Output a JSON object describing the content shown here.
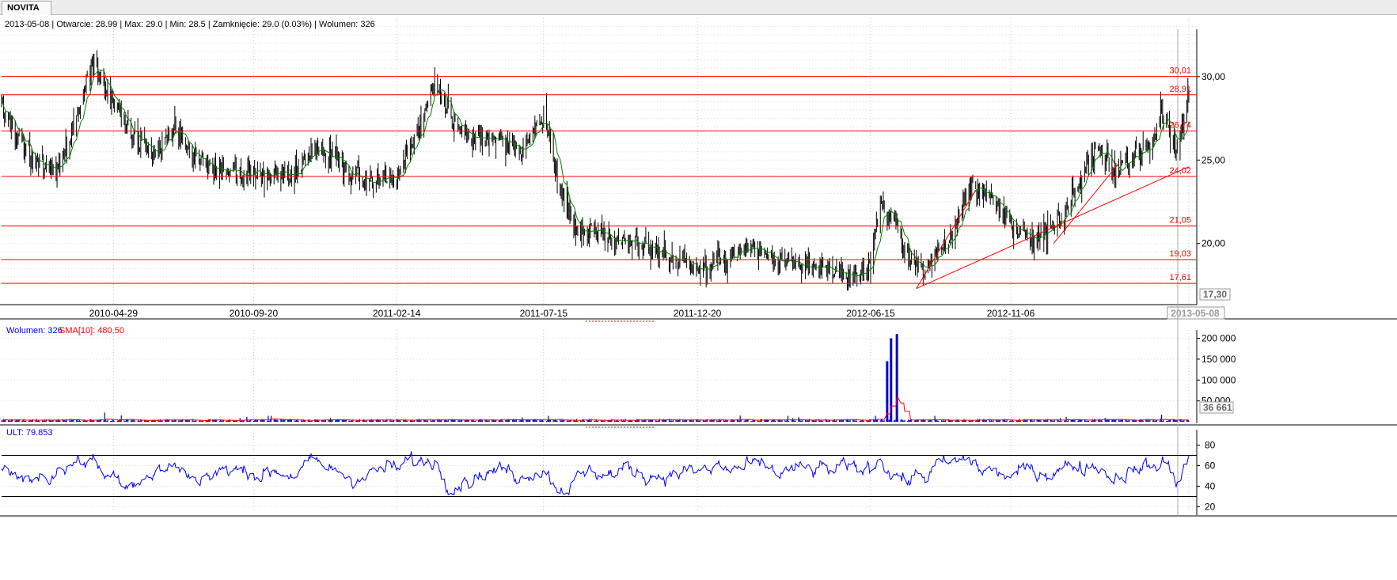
{
  "tabs": [
    {
      "label": "NOVITA"
    }
  ],
  "header": {
    "info_line": "2013-05-08 | Otwarcie: 28.99 | Max: 29.0 | Min: 28.5 | Zamknięcie: 29.0 (0.03%)  | Wolumen: 326"
  },
  "colors": {
    "price_bars": "#000000",
    "moving_average": "#008000",
    "horizontal_levels": "#ff0000",
    "trend_lines": "#ff0000",
    "volume_bars": "#0000cc",
    "volume_sma": "#ff0000",
    "ult_line": "#0000ff",
    "label_blue": "#0000ff",
    "label_red": "#ff0000",
    "grid": "#c8c8c8"
  },
  "chart_data": [
    {
      "type": "ohlc",
      "x_dates": [
        "2010-04-29",
        "2010-09-20",
        "2011-02-14",
        "2011-07-15",
        "2011-12-20",
        "2012-06-15",
        "2012-11-06",
        "2013-05-08"
      ],
      "x_current": "2013-05-08",
      "ylim": [
        17.0,
        33.5
      ],
      "y_ticks": [
        "20,00",
        "25,00",
        "30,00"
      ],
      "current_price_label": "17,30",
      "horizontal_levels": [
        "30,01",
        "28,91",
        "26,74",
        "24,02",
        "21,05",
        "19,03",
        "17,61"
      ],
      "approx_close_path": [
        {
          "date": "2010-01-04",
          "close": 28.2
        },
        {
          "date": "2010-02-01",
          "close": 25.2
        },
        {
          "date": "2010-03-01",
          "close": 24.2
        },
        {
          "date": "2010-03-22",
          "close": 27.5
        },
        {
          "date": "2010-04-07",
          "close": 30.8
        },
        {
          "date": "2010-04-19",
          "close": 29.8
        },
        {
          "date": "2010-05-10",
          "close": 27.2
        },
        {
          "date": "2010-06-10",
          "close": 25.2
        },
        {
          "date": "2010-07-01",
          "close": 27.2
        },
        {
          "date": "2010-07-20",
          "close": 25.0
        },
        {
          "date": "2010-08-20",
          "close": 24.2
        },
        {
          "date": "2010-09-20",
          "close": 24.3
        },
        {
          "date": "2010-11-01",
          "close": 24.1
        },
        {
          "date": "2010-11-24",
          "close": 26.0
        },
        {
          "date": "2010-12-20",
          "close": 24.3
        },
        {
          "date": "2011-01-20",
          "close": 23.8
        },
        {
          "date": "2011-02-14",
          "close": 24.0
        },
        {
          "date": "2011-03-10",
          "close": 27.0
        },
        {
          "date": "2011-03-24",
          "close": 29.8
        },
        {
          "date": "2011-04-15",
          "close": 27.0
        },
        {
          "date": "2011-05-10",
          "close": 26.2
        },
        {
          "date": "2011-06-15",
          "close": 26.0
        },
        {
          "date": "2011-06-24",
          "close": 25.2
        },
        {
          "date": "2011-07-04",
          "close": 27.0
        },
        {
          "date": "2011-07-15",
          "close": 27.5
        },
        {
          "date": "2011-08-01",
          "close": 23.5
        },
        {
          "date": "2011-08-15",
          "close": 21.0
        },
        {
          "date": "2011-09-15",
          "close": 20.6
        },
        {
          "date": "2011-10-15",
          "close": 20.0
        },
        {
          "date": "2011-11-15",
          "close": 19.4
        },
        {
          "date": "2011-12-20",
          "close": 18.5
        },
        {
          "date": "2012-01-10",
          "close": 18.9
        },
        {
          "date": "2012-02-15",
          "close": 19.6
        },
        {
          "date": "2012-03-20",
          "close": 18.9
        },
        {
          "date": "2012-04-20",
          "close": 18.6
        },
        {
          "date": "2012-05-25",
          "close": 18.0
        },
        {
          "date": "2012-06-15",
          "close": 18.6
        },
        {
          "date": "2012-06-25",
          "close": 22.5
        },
        {
          "date": "2012-07-10",
          "close": 21.2
        },
        {
          "date": "2012-07-25",
          "close": 19.0
        },
        {
          "date": "2012-08-10",
          "close": 18.4
        },
        {
          "date": "2012-09-10",
          "close": 21.0
        },
        {
          "date": "2012-09-25",
          "close": 23.6
        },
        {
          "date": "2012-10-20",
          "close": 22.6
        },
        {
          "date": "2012-11-06",
          "close": 21.0
        },
        {
          "date": "2012-12-10",
          "close": 20.3
        },
        {
          "date": "2013-01-10",
          "close": 22.8
        },
        {
          "date": "2013-02-01",
          "close": 25.8
        },
        {
          "date": "2013-02-22",
          "close": 24.3
        },
        {
          "date": "2013-03-10",
          "close": 25.2
        },
        {
          "date": "2013-04-01",
          "close": 26.0
        },
        {
          "date": "2013-04-10",
          "close": 28.3
        },
        {
          "date": "2013-04-25",
          "close": 25.4
        },
        {
          "date": "2013-05-08",
          "close": 29.0
        }
      ],
      "trend_lines": [
        {
          "from": {
            "date": "2012-08-01",
            "price": 17.3
          },
          "to": {
            "date": "2012-10-01",
            "price": 23.2
          }
        },
        {
          "from": {
            "date": "2012-08-01",
            "price": 17.3
          },
          "to": {
            "date": "2013-05-08",
            "price": 24.6
          }
        },
        {
          "from": {
            "date": "2012-12-20",
            "price": 20.0
          },
          "to": {
            "date": "2013-02-25",
            "price": 24.8
          }
        }
      ]
    },
    {
      "type": "bar",
      "legend_volume": "Wolumen: 326",
      "legend_sma": "SMA[10]: 480.50",
      "ylim": [
        0,
        220000
      ],
      "y_ticks": [
        "50 000",
        "100 000",
        "150 000",
        "200 000"
      ],
      "current_value_label": "36 661",
      "baseline_volume": 4000,
      "spikes": [
        {
          "date": "2012-07-02",
          "value": 145000
        },
        {
          "date": "2012-07-06",
          "value": 200000
        },
        {
          "date": "2012-07-12",
          "value": 210000
        },
        {
          "date": "2010-04-20",
          "value": 22000
        },
        {
          "date": "2011-02-20",
          "value": 20000
        },
        {
          "date": "2011-07-20",
          "value": 14000
        },
        {
          "date": "2012-08-20",
          "value": 14000
        },
        {
          "date": "2013-04-10",
          "value": 17000
        }
      ],
      "sma_peak": {
        "date": "2012-07-15",
        "value": 48000
      }
    },
    {
      "type": "line",
      "legend": "ULT: 79.853",
      "ylim": [
        15,
        95
      ],
      "y_ticks": [
        "20",
        "40",
        "60",
        "80"
      ],
      "reference_levels": [
        70,
        30
      ]
    }
  ]
}
